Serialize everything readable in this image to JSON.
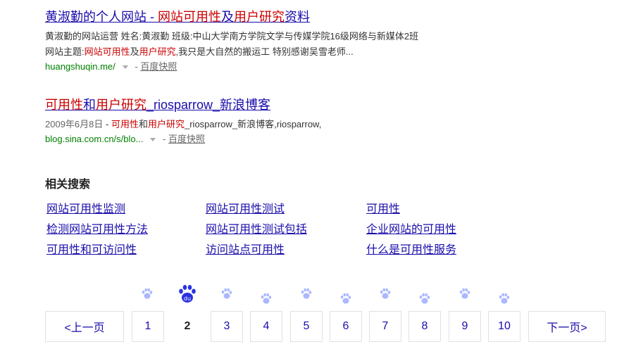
{
  "result1": {
    "title": [
      "黄淑勤的个人网站 - ",
      "网站可用性",
      "及",
      "用户研究",
      "资料"
    ],
    "line1": "黄淑勤的网站运营 姓名:黄淑勤 班级:中山大学南方学院文学与传媒学院16级网络与新媒体2班",
    "line2": [
      "网站主题:",
      "网站可用性",
      "及",
      "用户研究",
      ",我只是大自然的搬运工 特别感谢吴雪老师..."
    ],
    "url": "huangshuqin.me/",
    "snapshot": "百度快照"
  },
  "result2": {
    "title": [
      "可用性",
      "和",
      "用户研究",
      "_riosparrow_新浪博客"
    ],
    "desc": [
      "2009年6月8日",
      " - ",
      "可用性",
      "和",
      "用户研究",
      "_riosparrow_新浪博客,riosparrow,"
    ],
    "url": "blog.sina.com.cn/s/blo...",
    "snapshot": "百度快照"
  },
  "related": {
    "heading": "相关搜索",
    "items": [
      "网站可用性监测",
      "网站可用性测试",
      "可用性",
      "检测网站可用性方法",
      "网站可用性测试包括",
      "企业网站的可用性",
      "可用性和可访问性",
      "访问站点可用性",
      "什么是可用性服务"
    ]
  },
  "pagination": {
    "prev": "<上一页",
    "pages": [
      "1",
      "2",
      "3",
      "4",
      "5",
      "6",
      "7",
      "8",
      "9",
      "10"
    ],
    "current": "2",
    "next": "下一页>",
    "logo_text": "du"
  },
  "colors": {
    "link": "#1a0dab",
    "highlight": "#cc0000",
    "url": "#008000",
    "paw": "#aab8ff",
    "paw_active": "#2932e1"
  }
}
